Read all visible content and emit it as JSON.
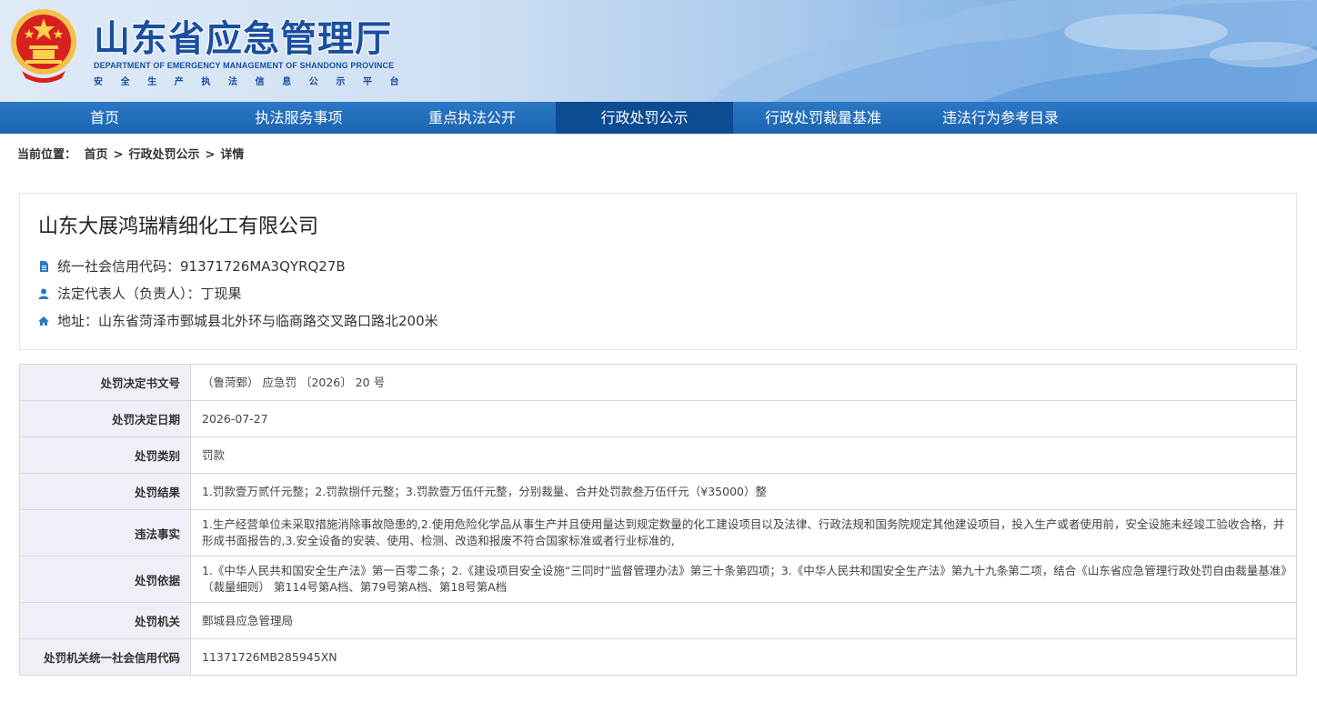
{
  "header": {
    "title": "山东省应急管理厅",
    "subtitle_en": "DEPARTMENT OF EMERGENCY MANAGEMENT OF SHANDONG PROVINCE",
    "platform": "安全生产执法信息公示平台"
  },
  "nav": {
    "items": [
      {
        "label": "首页"
      },
      {
        "label": "执法服务事项"
      },
      {
        "label": "重点执法公开"
      },
      {
        "label": "行政处罚公示"
      },
      {
        "label": "行政处罚裁量基准"
      },
      {
        "label": "违法行为参考目录"
      }
    ],
    "active_index": 3
  },
  "breadcrumb": {
    "prefix": "当前位置：",
    "items": [
      "首页",
      "行政处罚公示",
      "详情"
    ],
    "separator": ">"
  },
  "company": {
    "name": "山东大展鸿瑞精细化工有限公司",
    "credit_code": "统一社会信用代码：91371726MA3QYRQ27B",
    "legal_rep": "法定代表人（负责人）：丁现果",
    "address": "地址：山东省菏泽市鄄城县北外环与临商路交叉路口路北200米"
  },
  "details": [
    {
      "label": "处罚决定书文号",
      "value": "（鲁菏鄄） 应急罚 〔2026〕 20 号"
    },
    {
      "label": "处罚决定日期",
      "value": "2026-07-27"
    },
    {
      "label": "处罚类别",
      "value": "罚款"
    },
    {
      "label": "处罚结果",
      "value": "1.罚款壹万贰仟元整；2.罚款捌仟元整；3.罚款壹万伍仟元整，分别裁量、合并处罚款叁万伍仟元（¥35000）整"
    },
    {
      "label": "违法事实",
      "value": "1.生产经营单位未采取措施消除事故隐患的,2.使用危险化学品从事生产并且使用量达到规定数量的化工建设项目以及法律、行政法规和国务院规定其他建设项目，投入生产或者使用前，安全设施未经竣工验收合格，并形成书面报告的,3.安全设备的安装、使用、检测、改造和报废不符合国家标准或者行业标准的,"
    },
    {
      "label": "处罚依据",
      "value": "1.《中华人民共和国安全生产法》第一百零二条；2.《建设项目安全设施“三同时”监督管理办法》第三十条第四项；3.《中华人民共和国安全生产法》第九十九条第二项，结合《山东省应急管理行政处罚自由裁量基准》（裁量细则） 第114号第A档、第79号第A档、第18号第A档"
    },
    {
      "label": "处罚机关",
      "value": "鄄城县应急管理局"
    },
    {
      "label": "处罚机关统一社会信用代码",
      "value": "11371726MB285945XN"
    }
  ],
  "colors": {
    "nav_bg": "#1d64b0",
    "nav_active": "#0d4b93",
    "title_blue": "#1a4fa0",
    "table_label_bg": "#eef0f7",
    "icon_blue": "#2a78c6"
  }
}
